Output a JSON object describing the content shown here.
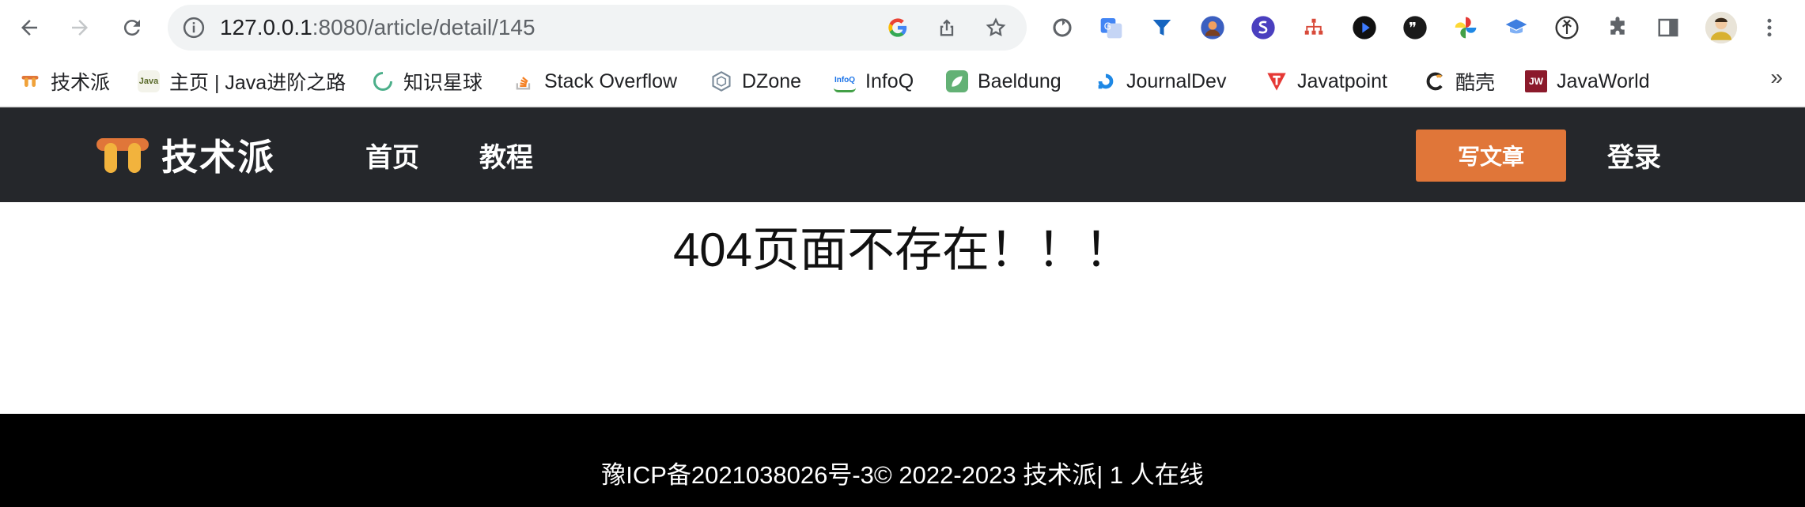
{
  "browser": {
    "url_host": "127.0.0.1",
    "url_rest": ":8080/article/detail/145"
  },
  "bookmarks": [
    {
      "label": "技术派",
      "icon": "tech-pai-icon",
      "color": "#e07639"
    },
    {
      "label": "主页 | Java进阶之路",
      "icon": "java-icon",
      "color": "#cfcfcf"
    },
    {
      "label": "知识星球",
      "icon": "planet-icon",
      "color": "#4caf8a"
    },
    {
      "label": "Stack Overflow",
      "icon": "stackoverflow-icon",
      "color": "#f48024"
    },
    {
      "label": "DZone",
      "icon": "dzone-icon",
      "color": "#7a8a99"
    },
    {
      "label": "InfoQ",
      "icon": "infoq-icon",
      "color": "#1a73e8"
    },
    {
      "label": "Baeldung",
      "icon": "baeldung-icon",
      "color": "#63b175"
    },
    {
      "label": "JournalDev",
      "icon": "journaldev-icon",
      "color": "#1e88e5"
    },
    {
      "label": "Javatpoint",
      "icon": "javatpoint-icon",
      "color": "#e53935"
    },
    {
      "label": "酷壳",
      "icon": "coolshell-icon",
      "color": "#222222"
    },
    {
      "label": "JavaWorld",
      "icon": "javaworld-icon",
      "color": "#8b1a2b"
    }
  ],
  "bookmarks_more": "»",
  "site": {
    "logo_text": "技术派",
    "nav": [
      "首页",
      "教程"
    ],
    "write_button": "写文章",
    "login": "登录"
  },
  "main": {
    "message": "404页面不存在！！！"
  },
  "footer": {
    "text": "豫ICP备2021038026号-3© 2022-2023 技术派| 1 人在线"
  },
  "colors": {
    "header_bg": "#25272b",
    "accent": "#e07639",
    "footer_bg": "#000000"
  }
}
